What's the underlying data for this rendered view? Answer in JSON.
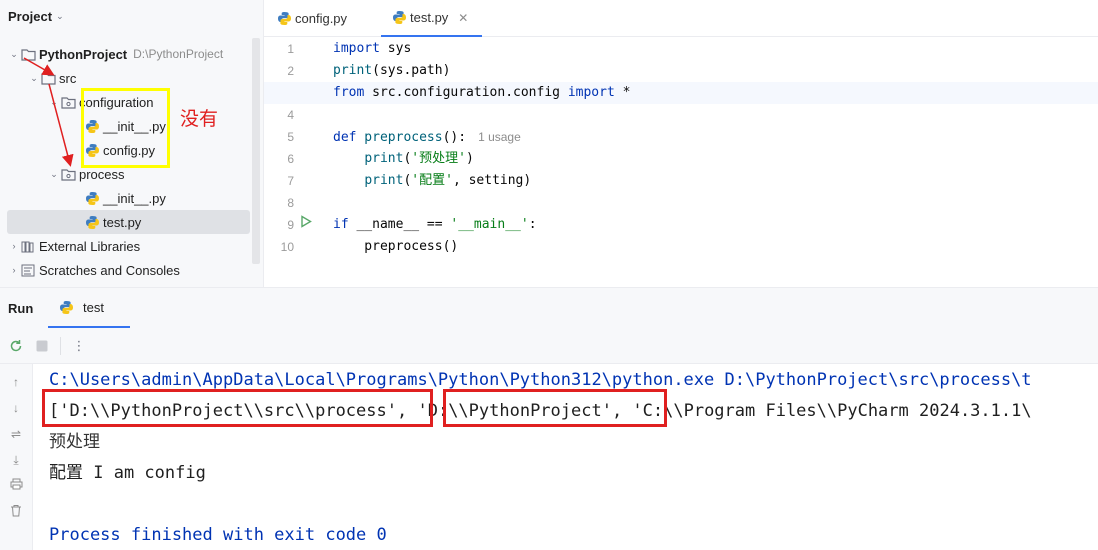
{
  "project": {
    "header": "Project",
    "root_name": "PythonProject",
    "root_path": "D:\\PythonProject",
    "tree": [
      {
        "label": "src"
      },
      {
        "label": "configuration"
      },
      {
        "label": "__init__.py"
      },
      {
        "label": "config.py"
      },
      {
        "label": "process"
      },
      {
        "label": "__init__.py"
      },
      {
        "label": "test.py"
      },
      {
        "label": "External Libraries"
      },
      {
        "label": "Scratches and Consoles"
      }
    ]
  },
  "editor": {
    "tabs": [
      {
        "label": "config.py"
      },
      {
        "label": "test.py"
      }
    ],
    "line_numbers": [
      "1",
      "2",
      "3",
      "4",
      "5",
      "6",
      "7",
      "8",
      "9",
      "10"
    ],
    "code": {
      "l1": {
        "kw": "import",
        "rest": " sys"
      },
      "l2": {
        "fn": "print",
        "rest": "(sys.path)"
      },
      "l3": {
        "kw1": "from",
        "mid": " src.configuration.config ",
        "kw2": "import",
        "rest": " *"
      },
      "l5": {
        "kw": "def",
        "fn": " preprocess",
        "rest": "():",
        "hint": "1 usage"
      },
      "l6": {
        "indent": "    ",
        "fn": "print",
        "open": "(",
        "str": "'预处理'",
        "close": ")"
      },
      "l7": {
        "indent": "    ",
        "fn": "print",
        "open": "(",
        "str": "'配置'",
        "rest": ", setting)"
      },
      "l9": {
        "kw": "if",
        "mid": " __name__ == ",
        "str": "'__main__'",
        "rest": ":"
      },
      "l10": {
        "rest": "    preprocess()"
      }
    }
  },
  "run": {
    "title": "Run",
    "tab_label": "test",
    "console": {
      "cmd": "C:\\Users\\admin\\AppData\\Local\\Programs\\Python\\Python312\\python.exe D:\\PythonProject\\src\\process\\t",
      "path_1": "['D:\\\\PythonProject\\\\src\\\\process'",
      "sep_1": ", ",
      "path_2": "'D:\\\\PythonProject'",
      "path_rest": ", 'C:\\\\Program Files\\\\PyCharm 2024.3.1.1\\",
      "out_1": "预处理",
      "out_2": "配置 I am config",
      "exit": "Process finished with exit code 0"
    }
  },
  "annotation": {
    "text": "没有",
    "colors": {
      "yellow": "#ffff00",
      "red": "#e02020"
    }
  }
}
